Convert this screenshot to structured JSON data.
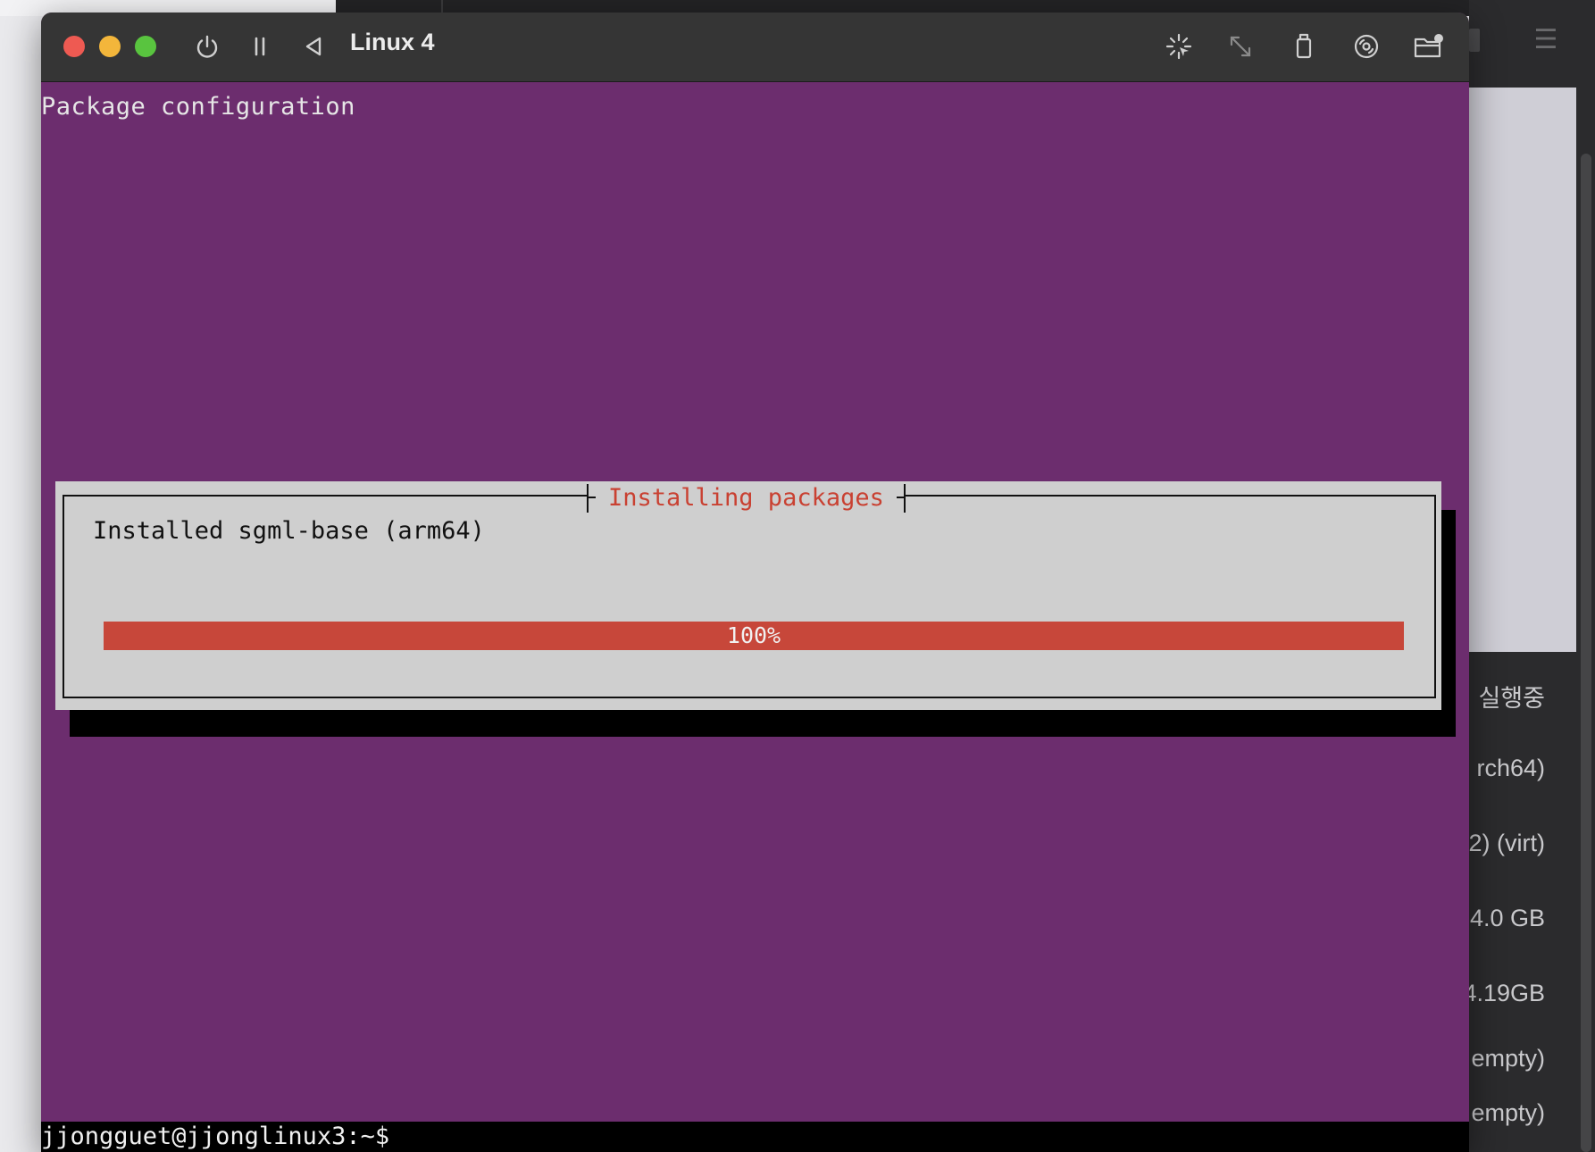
{
  "window": {
    "title": "Linux 4"
  },
  "toolbar": {
    "icons": [
      "power-icon",
      "pause-icon",
      "back-icon",
      "capture-icon",
      "resize-icon",
      "usb-icon",
      "disc-icon",
      "shared-folder-icon"
    ]
  },
  "terminal": {
    "header": "Package configuration",
    "dialog": {
      "title": "Installing packages",
      "message": "Installed sgml-base (arm64)",
      "progress_label": "100%",
      "progress_fraction": 1.0
    },
    "prompt": "jjongguet@jjonglinux3:~$"
  },
  "background_panel": {
    "status": "실행중",
    "details": [
      "rch64)",
      "2) (virt)",
      "4.0 GB",
      "4.19GB",
      "empty)",
      "empty)"
    ]
  },
  "colors": {
    "terminal_bg": "#6c2d6e",
    "dialog_bg": "#cfcfcf",
    "progress_fill": "#c7473a",
    "dialog_title": "#c94132",
    "titlebar_bg": "#353535"
  }
}
